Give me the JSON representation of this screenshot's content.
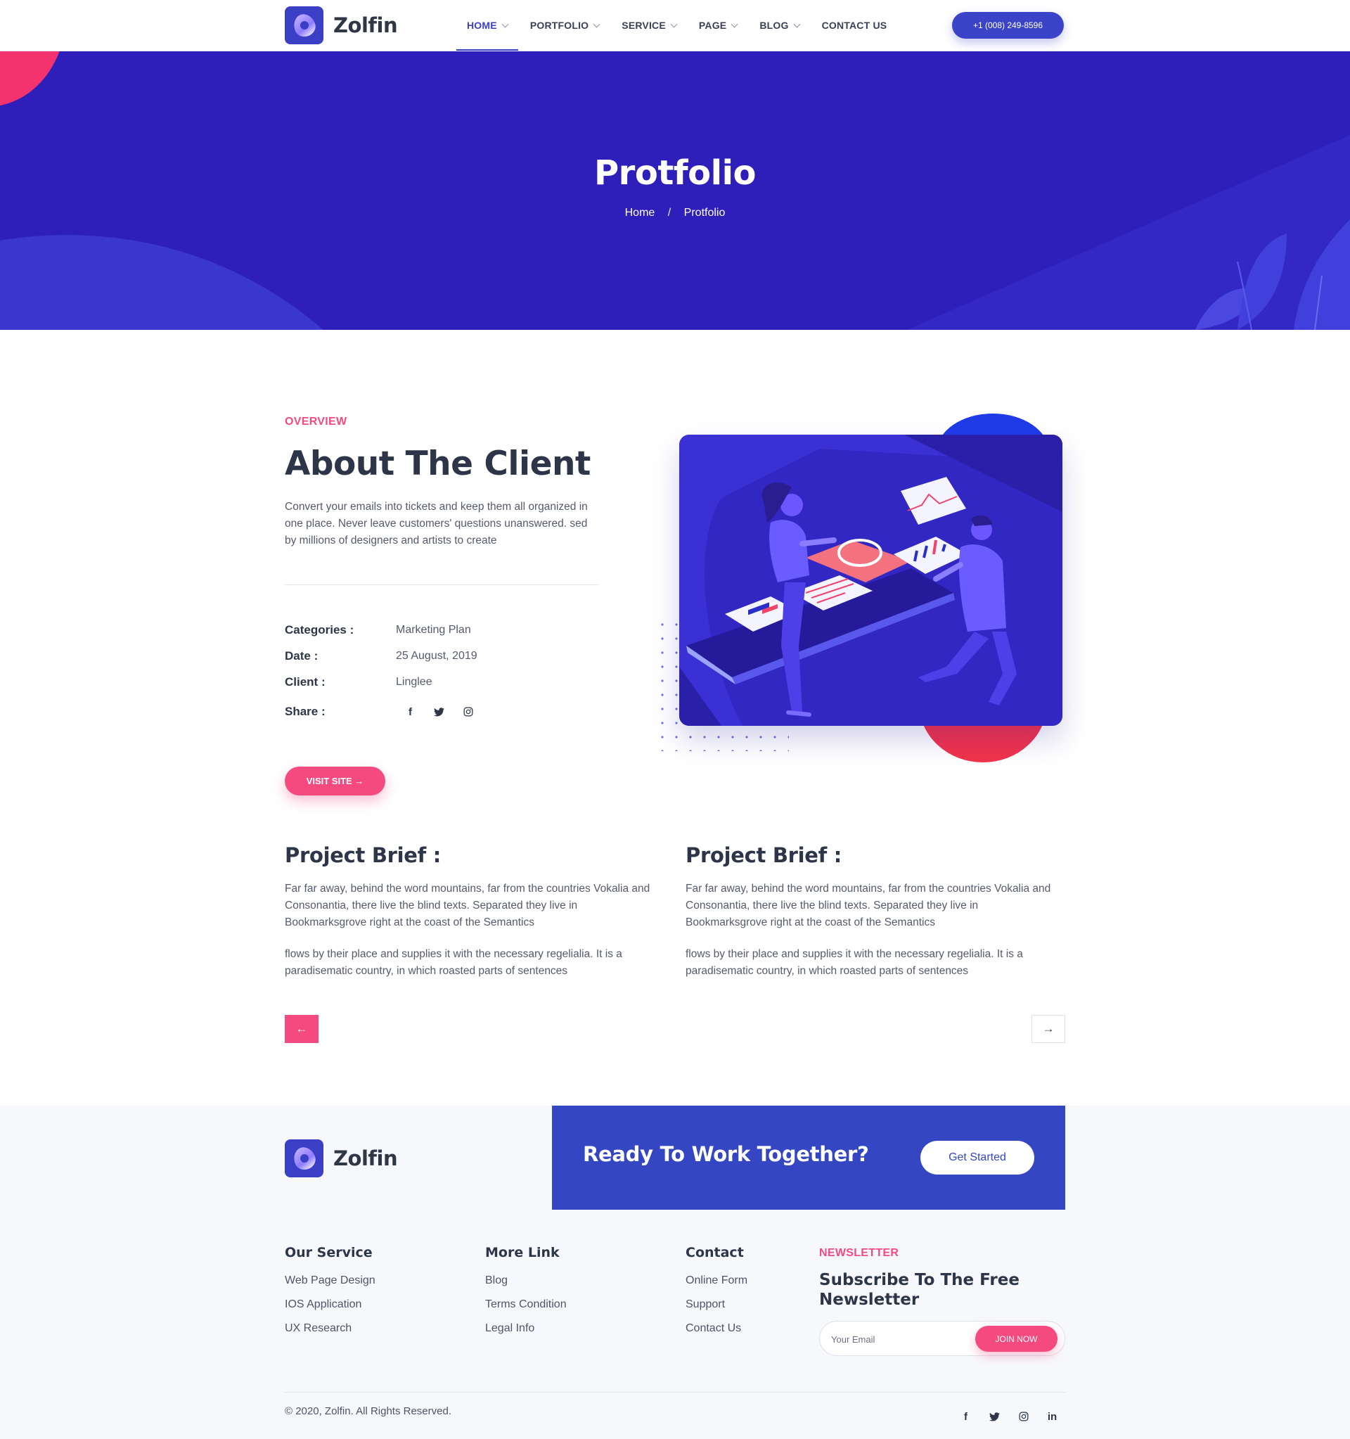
{
  "brand": {
    "name": "Zolfin",
    "primary": "#3b3fc6",
    "accent": "#f44a80",
    "hero_bg": "#2e1fbb"
  },
  "nav": {
    "items": [
      {
        "label": "HOME",
        "has_dropdown": true,
        "active": true
      },
      {
        "label": "PORTFOLIO",
        "has_dropdown": true
      },
      {
        "label": "SERVICE",
        "has_dropdown": true
      },
      {
        "label": "PAGE",
        "has_dropdown": true
      },
      {
        "label": "BLOG",
        "has_dropdown": true
      },
      {
        "label": "CONTACT US",
        "has_dropdown": false
      }
    ],
    "phone": "+1 (008) 249-8596"
  },
  "hero": {
    "title": "Protfolio",
    "breadcrumb": {
      "home": "Home",
      "separator": "/",
      "current": "Protfolio"
    }
  },
  "overview": {
    "eyebrow": "OVERVIEW",
    "title": "About The Client",
    "description_lines": [
      "Convert your emails into tickets and keep them all organized in",
      "one place. Never leave customers' questions unanswered. sed",
      "by millions of designers and artists to create"
    ],
    "meta": {
      "categories_label": "Categories :",
      "categories_value": "Marketing Plan",
      "date_label": "Date :",
      "date_value": "25 August, 2019",
      "client_label": "Client :",
      "client_value": "Linglee",
      "share_label": "Share :"
    },
    "share_icons": [
      "facebook-icon",
      "twitter-icon",
      "instagram-icon"
    ],
    "visit_label": "VISIT SITE →"
  },
  "briefs": [
    {
      "title": "Project Brief :",
      "p1_lines": [
        "Far far away, behind the word mountains, far from the countries Vokalia and",
        "Consonantia, there live the blind texts. Separated they live in",
        "Bookmarksgrove right at the coast of the Semantics"
      ],
      "p2_lines": [
        "flows by their place and supplies it with the necessary regelialia. It is a",
        "paradisematic country, in which roasted parts of sentences"
      ]
    },
    {
      "title": "Project Brief :",
      "p1_lines": [
        "Far far away, behind the word mountains, far from the countries Vokalia and",
        "Consonantia, there live the blind texts. Separated they live in",
        "Bookmarksgrove right at the coast of the Semantics"
      ],
      "p2_lines": [
        "flows by their place and supplies it with the necessary regelialia. It is a",
        "paradisematic country, in which roasted parts of sentences"
      ]
    }
  ],
  "pager": {
    "prev": "←",
    "next": "→"
  },
  "footer": {
    "cta_title": "Ready To Work Together?",
    "cta_button": "Get Started",
    "columns": [
      {
        "title": "Our Service",
        "links": [
          "Web Page Design",
          "IOS Application",
          "UX Research"
        ]
      },
      {
        "title": "More Link",
        "links": [
          "Blog",
          "Terms Condition",
          "Legal Info"
        ]
      },
      {
        "title": "Contact",
        "links": [
          "Online Form",
          "Support",
          "Contact Us"
        ]
      }
    ],
    "newsletter": {
      "eyebrow": "NEWSLETTER",
      "title": "Subscribe To The Free Newsletter",
      "placeholder": "Your Email",
      "button": "JOIN NOW"
    },
    "copyright": "© 2020, Zolfin. All Rights Reserved.",
    "social_icons": [
      "facebook-icon",
      "twitter-icon",
      "instagram-icon",
      "linkedin-icon"
    ]
  }
}
